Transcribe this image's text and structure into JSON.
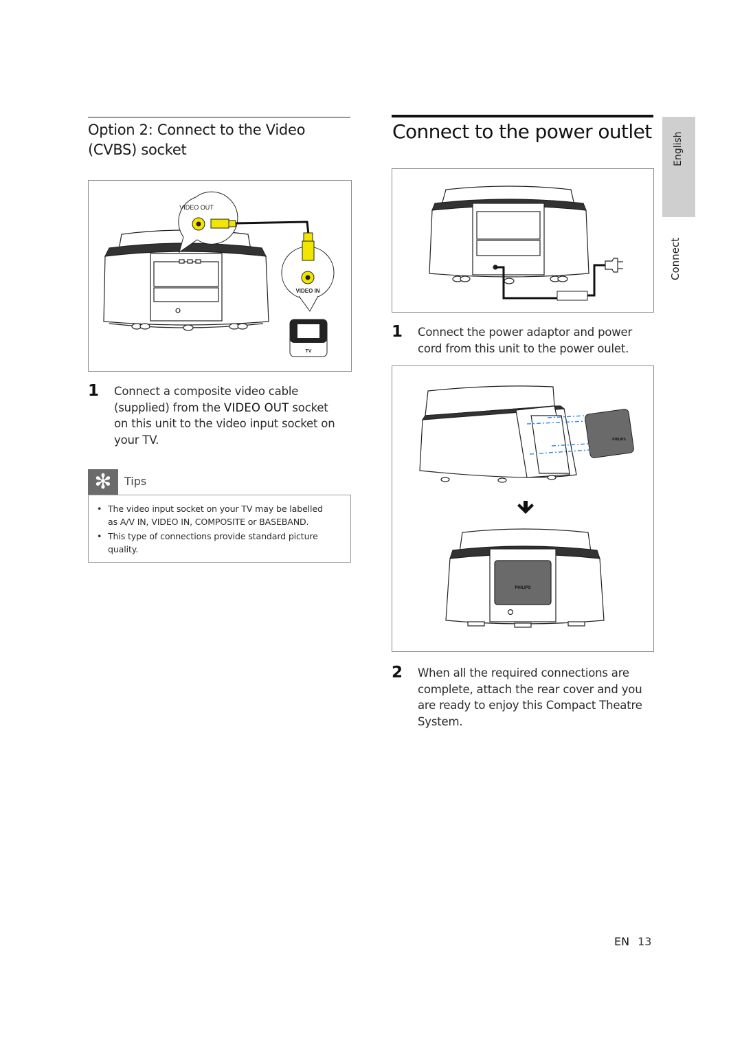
{
  "left_section": {
    "heading": "Option 2: Connect to the Video (CVBS) socket",
    "figure": {
      "callout_out_label": "VIDEO OUT",
      "callout_in_label": "VIDEO IN",
      "tv_label": "TV",
      "cable_color": "#f2e600"
    },
    "step1": {
      "number": "1",
      "line1": "Connect a composite video cable",
      "line2_pre": "(supplied) from the ",
      "line2_bold": "VIDEO OUT",
      "line2_post": " socket",
      "line3": "on this unit to the video input socket on",
      "line4": "your TV."
    },
    "tips": {
      "icon": "asterisk-icon",
      "label": "Tips",
      "items": [
        {
          "line1": "The video input socket on your TV may be labelled",
          "line2": "as A/V IN, VIDEO IN, COMPOSITE or BASEBAND."
        },
        {
          "line1": "This type of connections provide standard picture",
          "line2": "quality."
        }
      ]
    }
  },
  "right_section": {
    "heading": "Connect to the power outlet",
    "step1": {
      "number": "1",
      "line1": "Connect the power adaptor and power",
      "line2": "cord from this unit to the power oulet."
    },
    "figure2": {
      "brand_label": "PHILIPS",
      "arrow_icon": "arrow-down-icon",
      "guide_color": "#3a8ee6"
    },
    "step2": {
      "number": "2",
      "line1": "When all the required connections are",
      "line2": "complete, attach the rear cover and you",
      "line3": "are ready to enjoy this Compact Theatre",
      "line4": "System."
    }
  },
  "side_tabs": {
    "language": "English",
    "chapter": "Connect"
  },
  "footer": {
    "lang": "EN",
    "page": "13"
  }
}
